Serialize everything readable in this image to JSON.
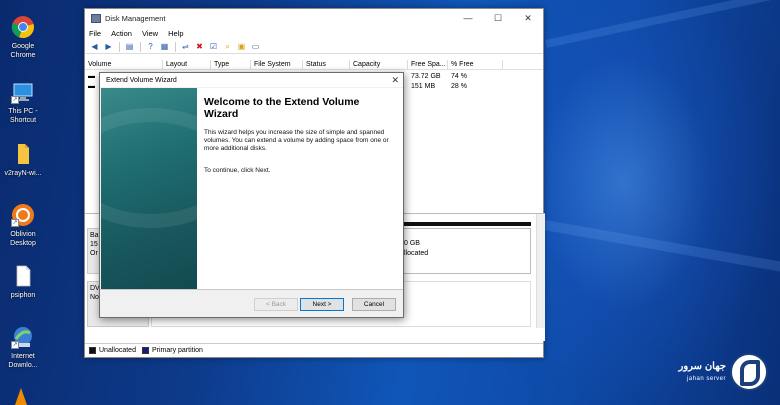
{
  "desktop": {
    "icons": [
      {
        "label": "Google Chrome",
        "icon": "chrome-icon"
      },
      {
        "label": "This PC - Shortcut",
        "icon": "computer-icon"
      },
      {
        "label": "v2rayN-wi...",
        "icon": "folder-icon"
      },
      {
        "label": "Oblivion Desktop",
        "icon": "oblivion-icon"
      },
      {
        "label": "psiphon",
        "icon": "file-icon"
      },
      {
        "label": "Internet Downlo...",
        "icon": "idm-icon"
      }
    ]
  },
  "disk_management": {
    "title": "Disk Management",
    "menu": [
      "File",
      "Action",
      "View",
      "Help"
    ],
    "columns": [
      "Volume",
      "Layout",
      "Type",
      "File System",
      "Status",
      "Capacity",
      "Free Spa...",
      "% Free"
    ],
    "rows": [
      {
        "free": "73.72 GB",
        "pct": "74 %"
      },
      {
        "free": "151 MB",
        "pct": "28 %"
      }
    ],
    "lower": {
      "disk0_partial": [
        "Ba",
        "15",
        "Or"
      ],
      "disk1_partial": [
        "DV",
        "",
        "No"
      ],
      "unalloc_size": "0 GB",
      "unalloc_label": "llocated"
    },
    "legend": [
      {
        "label": "Unallocated",
        "color": "#111111"
      },
      {
        "label": "Primary partition",
        "color": "#1a1a7a"
      }
    ]
  },
  "wizard": {
    "title": "Extend Volume Wizard",
    "heading": "Welcome to the Extend Volume Wizard",
    "description": "This wizard helps you increase the size of simple and spanned volumes. You can extend a volume  by adding space from one or more additional disks.",
    "continue_text": "To continue, click Next.",
    "buttons": {
      "back": "< Back",
      "next": "Next >",
      "cancel": "Cancel"
    }
  },
  "watermark": {
    "line1": "جهان سرور",
    "line2": "jahan server"
  }
}
